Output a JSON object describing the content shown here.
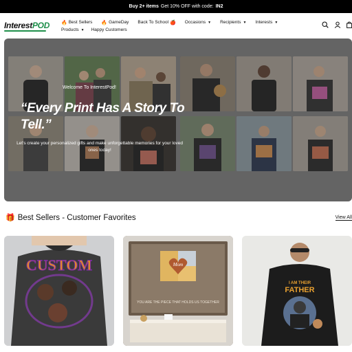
{
  "announcement": {
    "bold": "Buy 2+ items",
    "text": "Get 10% OFF with code:",
    "code": "IN2"
  },
  "brand": {
    "logo_part1": "Interest",
    "logo_part2": "POD"
  },
  "nav": {
    "row1": [
      {
        "label": "Best Sellers",
        "icon": "fire-icon"
      },
      {
        "label": "GameDay",
        "icon": "fire-icon"
      },
      {
        "label": "Back To School",
        "icon": "apple-icon"
      },
      {
        "label": "Occasions",
        "icon": "chevron-down-icon"
      },
      {
        "label": "Recipients",
        "icon": "chevron-down-icon"
      },
      {
        "label": "Interests",
        "icon": "chevron-down-icon"
      }
    ],
    "row2": [
      {
        "label": "Products",
        "icon": "chevron-down-icon"
      },
      {
        "label": "Happy Customers"
      }
    ]
  },
  "hero": {
    "welcome": "Welcome To InterestPod!",
    "headline": "“Every Print Has A Story To Tell.”",
    "subline": "Let's create your personalized gifts and make unforgettable memories for your loved ones today!"
  },
  "best_sellers": {
    "title": "Best Sellers - Customer Favorites",
    "view_all": "View All",
    "products": [
      {
        "image_text": "CUSTOM"
      },
      {
        "image_text_1": "Mom",
        "image_text_2": "YOU ARE THE PIECE THAT HOLDS US TOGETHER"
      },
      {
        "image_text_1": "I AM THEIR",
        "image_text_2": "FATHER"
      }
    ]
  },
  "colors": {
    "brand_green": "#1e8f4a",
    "fire": "#f05a1a",
    "announce_bg": "#000000"
  }
}
